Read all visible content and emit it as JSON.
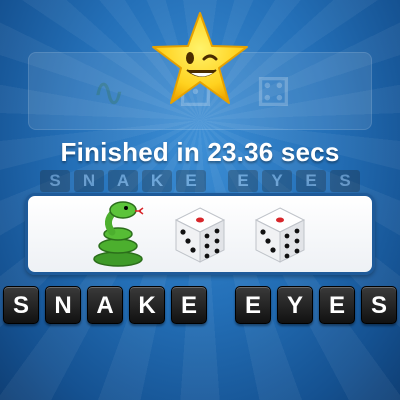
{
  "result": {
    "message": "Finished in 23.36 secs",
    "rating_icon": "winking-star-icon"
  },
  "puzzle": {
    "emojis": [
      "snake-icon",
      "die-icon",
      "die-icon"
    ],
    "answer_words": [
      [
        "S",
        "N",
        "A",
        "K",
        "E"
      ],
      [
        "E",
        "Y",
        "E",
        "S"
      ]
    ]
  },
  "ghost": {
    "emojis": [
      "snake-icon",
      "die-icon",
      "die-icon"
    ],
    "answer_words": [
      [
        "S",
        "N",
        "A",
        "K",
        "E"
      ],
      [
        "E",
        "Y",
        "E",
        "S"
      ]
    ]
  },
  "colors": {
    "background": "#2470b8",
    "star": "#ffd21f",
    "tile": "#111111",
    "snake": "#4caf2e",
    "die_pip_red": "#d8262a"
  }
}
